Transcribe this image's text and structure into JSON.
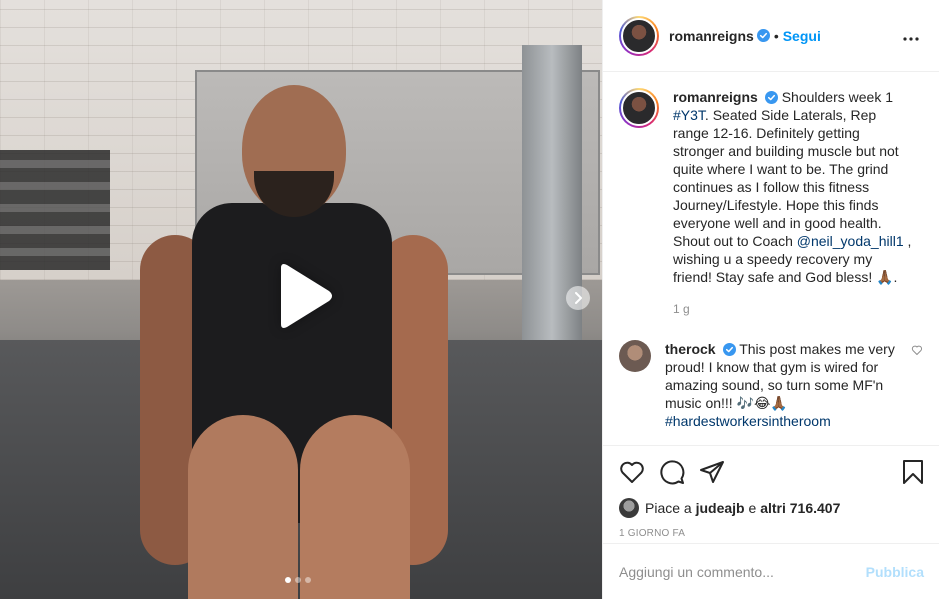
{
  "header": {
    "username": "romanreigns",
    "separator": "•",
    "follow_label": "Segui",
    "more_label": "•••"
  },
  "caption": {
    "username": "romanreigns",
    "text_1": "Shoulders week 1",
    "hashtag_1": "#Y3T",
    "text_2": ". Seated Side Laterals, Rep range 12-16. Definitely getting stronger and building muscle but not quite where I want to be. The grind continues as I follow this fitness Journey/Lifestyle. Hope this finds everyone well and in good health. Shout out to Coach",
    "mention_1": "@neil_yoda_hill1",
    "text_3": ", wishing u a speedy recovery my friend! Stay safe and God bless! 🙏🏾.",
    "time": "1 g"
  },
  "comments": [
    {
      "username": "therock",
      "text": "This post makes me very proud! I know that gym is wired for amazing sound, so turn some MF'n music on!!! 🎶😂🙏🏾",
      "hashtag": "#hardestworkersintheroom"
    }
  ],
  "likes": {
    "prefix": "Piace a",
    "user": "judeajb",
    "middle": "e",
    "others": "altri 716.407"
  },
  "date_label": "1 GIORNO FA",
  "add_comment": {
    "placeholder": "Aggiungi un commento...",
    "publish_label": "Pubblica"
  },
  "media": {
    "carousel_count": 3,
    "carousel_active": 0
  },
  "colors": {
    "accent": "#0095f6",
    "link": "#00376b",
    "muted": "#8e8e8e",
    "publish_disabled": "#b2dffc"
  }
}
